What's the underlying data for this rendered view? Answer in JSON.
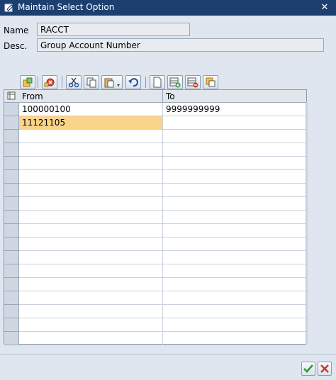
{
  "window": {
    "title": "Maintain Select Option"
  },
  "fields": {
    "name_label": "Name",
    "name_value": "RACCT",
    "desc_label": "Desc.",
    "desc_value": "Group Account Number"
  },
  "table": {
    "headers": [
      "From",
      "To"
    ],
    "rows": [
      {
        "from": "100000100",
        "to": "9999999999"
      },
      {
        "from": "11121105",
        "to": ""
      },
      {
        "from": "",
        "to": ""
      },
      {
        "from": "",
        "to": ""
      },
      {
        "from": "",
        "to": ""
      },
      {
        "from": "",
        "to": ""
      },
      {
        "from": "",
        "to": ""
      },
      {
        "from": "",
        "to": ""
      },
      {
        "from": "",
        "to": ""
      },
      {
        "from": "",
        "to": ""
      },
      {
        "from": "",
        "to": ""
      },
      {
        "from": "",
        "to": ""
      },
      {
        "from": "",
        "to": ""
      },
      {
        "from": "",
        "to": ""
      },
      {
        "from": "",
        "to": ""
      },
      {
        "from": "",
        "to": ""
      },
      {
        "from": "",
        "to": ""
      },
      {
        "from": "",
        "to": ""
      }
    ],
    "selected_row": 1
  },
  "toolbar": {
    "icons": [
      "multiple-selection-icon",
      "delete-selection-icon",
      "cut-icon",
      "copy-icon",
      "paste-icon",
      "undo-icon",
      "new-entry-icon",
      "insert-row-icon",
      "delete-row-icon",
      "copy-row-icon"
    ]
  },
  "footer": {
    "ok_icon": "checkmark-icon",
    "cancel_icon": "cancel-icon"
  }
}
